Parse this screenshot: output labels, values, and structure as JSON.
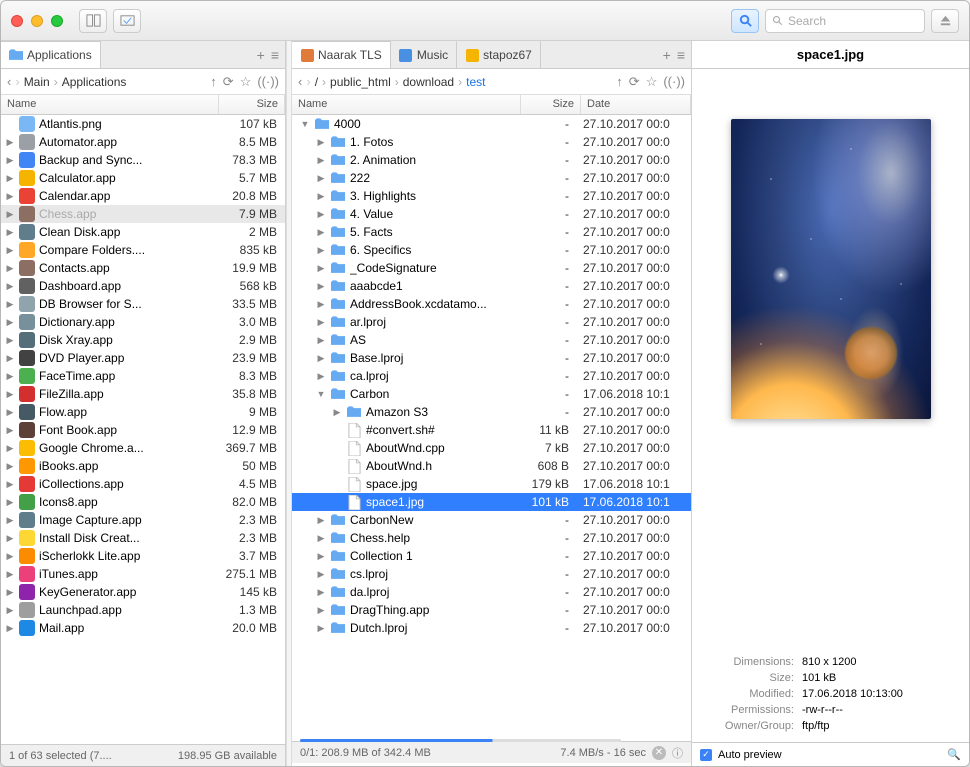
{
  "toolbar": {
    "search_placeholder": "Search"
  },
  "left": {
    "tab": "Applications",
    "path": [
      "Main",
      "Applications"
    ],
    "cols": {
      "name": "Name",
      "size": "Size"
    },
    "items": [
      {
        "n": "Atlantis.png",
        "s": "107 kB",
        "a": 0,
        "c": "#7ab8f5",
        "t": "img"
      },
      {
        "n": "Automator.app",
        "s": "8.5 MB",
        "a": 1,
        "c": "#9aa0a6",
        "t": "app"
      },
      {
        "n": "Backup and Sync...",
        "s": "78.3 MB",
        "a": 1,
        "c": "#4285f4",
        "t": "app"
      },
      {
        "n": "Calculator.app",
        "s": "5.7 MB",
        "a": 1,
        "c": "#f4b400",
        "t": "app"
      },
      {
        "n": "Calendar.app",
        "s": "20.8 MB",
        "a": 1,
        "c": "#ea4335",
        "t": "app"
      },
      {
        "n": "Chess.app",
        "s": "7.9 MB",
        "a": 1,
        "c": "#8d6e63",
        "t": "app",
        "sel": true
      },
      {
        "n": "Clean Disk.app",
        "s": "2 MB",
        "a": 1,
        "c": "#607d8b",
        "t": "app"
      },
      {
        "n": "Compare Folders....",
        "s": "835 kB",
        "a": 1,
        "c": "#ffa726",
        "t": "app"
      },
      {
        "n": "Contacts.app",
        "s": "19.9 MB",
        "a": 1,
        "c": "#8d6e63",
        "t": "app"
      },
      {
        "n": "Dashboard.app",
        "s": "568 kB",
        "a": 1,
        "c": "#616161",
        "t": "app"
      },
      {
        "n": "DB Browser for S...",
        "s": "33.5 MB",
        "a": 1,
        "c": "#90a4ae",
        "t": "app"
      },
      {
        "n": "Dictionary.app",
        "s": "3.0 MB",
        "a": 1,
        "c": "#78909c",
        "t": "app"
      },
      {
        "n": "Disk Xray.app",
        "s": "2.9 MB",
        "a": 1,
        "c": "#546e7a",
        "t": "app"
      },
      {
        "n": "DVD Player.app",
        "s": "23.9 MB",
        "a": 1,
        "c": "#424242",
        "t": "app"
      },
      {
        "n": "FaceTime.app",
        "s": "8.3 MB",
        "a": 1,
        "c": "#4caf50",
        "t": "app"
      },
      {
        "n": "FileZilla.app",
        "s": "35.8 MB",
        "a": 1,
        "c": "#d32f2f",
        "t": "app"
      },
      {
        "n": "Flow.app",
        "s": "9 MB",
        "a": 1,
        "c": "#455a64",
        "t": "app"
      },
      {
        "n": "Font Book.app",
        "s": "12.9 MB",
        "a": 1,
        "c": "#5d4037",
        "t": "app"
      },
      {
        "n": "Google Chrome.a...",
        "s": "369.7 MB",
        "a": 1,
        "c": "#fbbc04",
        "t": "app"
      },
      {
        "n": "iBooks.app",
        "s": "50 MB",
        "a": 1,
        "c": "#ff9800",
        "t": "app"
      },
      {
        "n": "iCollections.app",
        "s": "4.5 MB",
        "a": 1,
        "c": "#e53935",
        "t": "app"
      },
      {
        "n": "Icons8.app",
        "s": "82.0 MB",
        "a": 1,
        "c": "#43a047",
        "t": "app"
      },
      {
        "n": "Image Capture.app",
        "s": "2.3 MB",
        "a": 1,
        "c": "#607d8b",
        "t": "app"
      },
      {
        "n": "Install Disk Creat...",
        "s": "2.3 MB",
        "a": 1,
        "c": "#fdd835",
        "t": "app"
      },
      {
        "n": "iScherlokk Lite.app",
        "s": "3.7 MB",
        "a": 1,
        "c": "#fb8c00",
        "t": "app"
      },
      {
        "n": "iTunes.app",
        "s": "275.1 MB",
        "a": 1,
        "c": "#ec407a",
        "t": "app"
      },
      {
        "n": "KeyGenerator.app",
        "s": "145 kB",
        "a": 1,
        "c": "#8e24aa",
        "t": "app"
      },
      {
        "n": "Launchpad.app",
        "s": "1.3 MB",
        "a": 1,
        "c": "#9e9e9e",
        "t": "app"
      },
      {
        "n": "Mail.app",
        "s": "20.0 MB",
        "a": 1,
        "c": "#1e88e5",
        "t": "app"
      }
    ],
    "status": {
      "l": "1 of 63 selected (7....",
      "r": "198.95 GB available"
    }
  },
  "mid": {
    "tabs": [
      {
        "n": "Naarak TLS",
        "active": true,
        "c": "#e07b3c"
      },
      {
        "n": "Music",
        "c": "#4a90e2"
      },
      {
        "n": "stapoz67",
        "c": "#f4b400"
      }
    ],
    "path": [
      "/",
      "public_html",
      "download",
      "test"
    ],
    "cols": {
      "name": "Name",
      "size": "Size",
      "date": "Date"
    },
    "items": [
      {
        "i": 0,
        "n": "4000",
        "s": "-",
        "d": "27.10.2017 00:0",
        "t": "f",
        "o": 1
      },
      {
        "i": 1,
        "n": "1. Fotos",
        "s": "-",
        "d": "27.10.2017 00:0",
        "t": "f"
      },
      {
        "i": 1,
        "n": "2. Animation",
        "s": "-",
        "d": "27.10.2017 00:0",
        "t": "f"
      },
      {
        "i": 1,
        "n": "222",
        "s": "-",
        "d": "27.10.2017 00:0",
        "t": "f"
      },
      {
        "i": 1,
        "n": "3. Highlights",
        "s": "-",
        "d": "27.10.2017 00:0",
        "t": "f"
      },
      {
        "i": 1,
        "n": "4. Value",
        "s": "-",
        "d": "27.10.2017 00:0",
        "t": "f"
      },
      {
        "i": 1,
        "n": "5. Facts",
        "s": "-",
        "d": "27.10.2017 00:0",
        "t": "f"
      },
      {
        "i": 1,
        "n": "6. Specifics",
        "s": "-",
        "d": "27.10.2017 00:0",
        "t": "f"
      },
      {
        "i": 1,
        "n": "_CodeSignature",
        "s": "-",
        "d": "27.10.2017 00:0",
        "t": "f"
      },
      {
        "i": 1,
        "n": "aaabcde1",
        "s": "-",
        "d": "27.10.2017 00:0",
        "t": "f"
      },
      {
        "i": 1,
        "n": "AddressBook.xcdatamo...",
        "s": "-",
        "d": "27.10.2017 00:0",
        "t": "f"
      },
      {
        "i": 1,
        "n": "ar.lproj",
        "s": "-",
        "d": "27.10.2017 00:0",
        "t": "f"
      },
      {
        "i": 1,
        "n": "AS",
        "s": "-",
        "d": "27.10.2017 00:0",
        "t": "f"
      },
      {
        "i": 1,
        "n": "Base.lproj",
        "s": "-",
        "d": "27.10.2017 00:0",
        "t": "f"
      },
      {
        "i": 1,
        "n": "ca.lproj",
        "s": "-",
        "d": "27.10.2017 00:0",
        "t": "f"
      },
      {
        "i": 1,
        "n": "Carbon",
        "s": "-",
        "d": "17.06.2018 10:1",
        "t": "f",
        "o": 1
      },
      {
        "i": 2,
        "n": "Amazon S3",
        "s": "-",
        "d": "27.10.2017 00:0",
        "t": "f"
      },
      {
        "i": 2,
        "n": "#convert.sh#",
        "s": "11 kB",
        "d": "27.10.2017 00:0",
        "t": "file"
      },
      {
        "i": 2,
        "n": "AboutWnd.cpp",
        "s": "7 kB",
        "d": "27.10.2017 00:0",
        "t": "file"
      },
      {
        "i": 2,
        "n": "AboutWnd.h",
        "s": "608 B",
        "d": "27.10.2017 00:0",
        "t": "h"
      },
      {
        "i": 2,
        "n": "space.jpg",
        "s": "179 kB",
        "d": "17.06.2018 10:1",
        "t": "img"
      },
      {
        "i": 2,
        "n": "space1.jpg",
        "s": "101 kB",
        "d": "17.06.2018 10:1",
        "t": "img",
        "blue": true
      },
      {
        "i": 1,
        "n": "CarbonNew",
        "s": "-",
        "d": "27.10.2017 00:0",
        "t": "f"
      },
      {
        "i": 1,
        "n": "Chess.help",
        "s": "-",
        "d": "27.10.2017 00:0",
        "t": "f"
      },
      {
        "i": 1,
        "n": "Collection 1",
        "s": "-",
        "d": "27.10.2017 00:0",
        "t": "f"
      },
      {
        "i": 1,
        "n": "cs.lproj",
        "s": "-",
        "d": "27.10.2017 00:0",
        "t": "f"
      },
      {
        "i": 1,
        "n": "da.lproj",
        "s": "-",
        "d": "27.10.2017 00:0",
        "t": "f"
      },
      {
        "i": 1,
        "n": "DragThing.app",
        "s": "-",
        "d": "27.10.2017 00:0",
        "t": "f"
      },
      {
        "i": 1,
        "n": "Dutch.lproj",
        "s": "-",
        "d": "27.10.2017 00:0",
        "t": "f"
      }
    ],
    "status": {
      "l": "0/1: 208.9 MB of 342.4 MB",
      "r": "7.4 MB/s - 16 sec"
    }
  },
  "preview": {
    "title": "space1.jpg",
    "meta": [
      {
        "k": "Dimensions:",
        "v": "810 x 1200"
      },
      {
        "k": "Size:",
        "v": "101 kB"
      },
      {
        "k": "Modified:",
        "v": "17.06.2018 10:13:00"
      },
      {
        "k": "Permissions:",
        "v": "-rw-r--r--"
      },
      {
        "k": "Owner/Group:",
        "v": "ftp/ftp"
      }
    ],
    "auto": "Auto preview"
  }
}
